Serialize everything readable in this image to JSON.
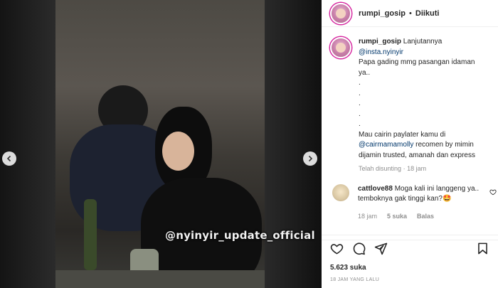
{
  "post": {
    "username": "rumpi_gosip",
    "dot": "•",
    "follow_label": "Diikuti",
    "watermark": "@nyinyir_update_official"
  },
  "caption": {
    "username": "rumpi_gosip",
    "lead": "Lanjutannya",
    "mention": "@insta.nyinyir",
    "line1": "Papa gading mmg pasangan idaman",
    "line2": "ya..",
    "dots": [
      ".",
      ".",
      ".",
      ".",
      "."
    ],
    "promo1": "Mau cairin paylater kamu di",
    "promo_mention": "@cairmamamolly",
    "promo2": " recomen by mimin dijamin trusted, amanah dan express",
    "edited": "Telah disunting",
    "sep": "·",
    "age": "18 jam"
  },
  "reply": {
    "username": "cattlove88",
    "text": " Moga kali ini langgeng ya.. temboknya gak tinggi kan?",
    "emoji": "🤩",
    "age": "18 jam",
    "likes": "5 suka",
    "reply_label": "Balas"
  },
  "footer": {
    "likes": "5.623 suka",
    "time": "18 JAM YANG LALU"
  },
  "icons": [
    "chevron-left-icon",
    "chevron-right-icon",
    "heart-icon",
    "comment-icon",
    "share-icon",
    "bookmark-icon"
  ],
  "colors": {
    "accent_ring": "#d6249f",
    "link": "#00376b",
    "muted": "#8e8e8e",
    "text": "#262626"
  }
}
